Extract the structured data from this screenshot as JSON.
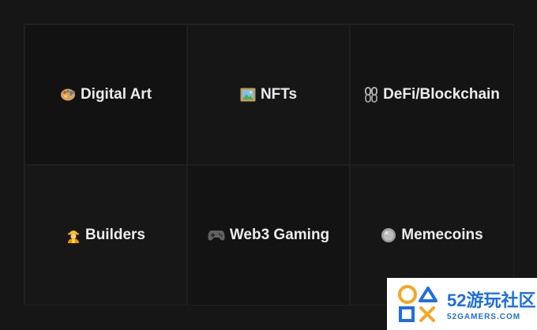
{
  "categories": [
    {
      "label": "Digital Art",
      "icon": "palette-icon"
    },
    {
      "label": "NFTs",
      "icon": "framed-picture-icon"
    },
    {
      "label": "DeFi/Blockchain",
      "icon": "chain-icon"
    },
    {
      "label": "Builders",
      "icon": "construction-worker-icon"
    },
    {
      "label": "Web3 Gaming",
      "icon": "game-controller-icon"
    },
    {
      "label": "Memecoins",
      "icon": "coin-icon"
    }
  ],
  "watermark": {
    "main": "52游玩社区",
    "sub": "52GAMERS.COM"
  }
}
